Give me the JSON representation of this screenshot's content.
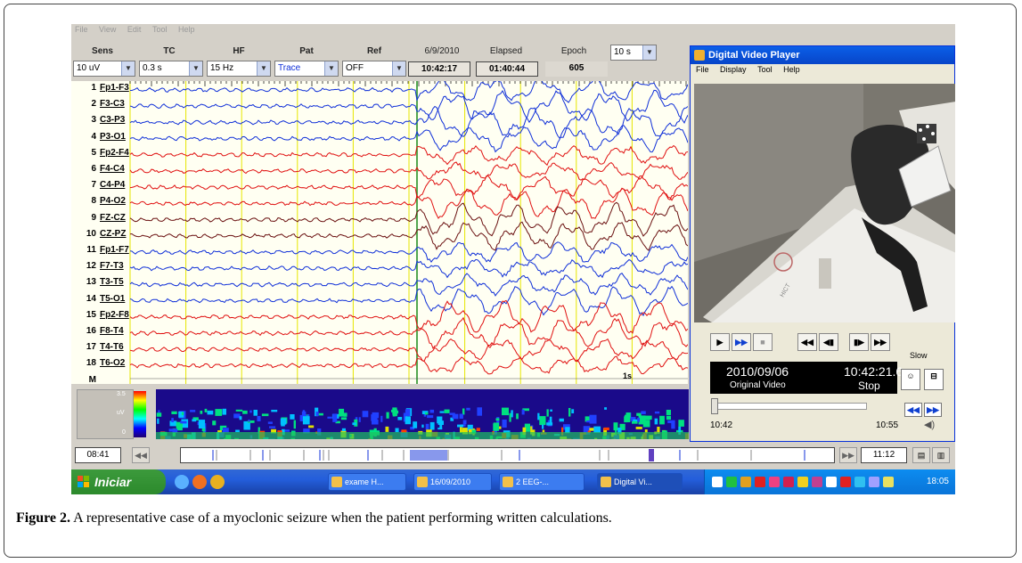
{
  "menubar": [
    "File",
    "View",
    "Edit",
    "Tool",
    "Help"
  ],
  "controls": {
    "labels": {
      "sens": "Sens",
      "tc": "TC",
      "hf": "HF",
      "pat": "Pat",
      "ref": "Ref",
      "date": "6/9/2010",
      "elapsed": "Elapsed",
      "epoch": "Epoch"
    },
    "sens_value": "10 uV",
    "tc_value": "0.3 s",
    "hf_value": "15 Hz",
    "pat_value": "Trace",
    "ref_value": "OFF",
    "clock_time": "10:42:17",
    "elapsed_time": "01:40:44",
    "epoch_value": "605",
    "window_value": "10 s"
  },
  "channels": [
    {
      "n": "1",
      "label": "Fp1-F3"
    },
    {
      "n": "2",
      "label": "F3-C3"
    },
    {
      "n": "3",
      "label": "C3-P3"
    },
    {
      "n": "4",
      "label": "P3-O1"
    },
    {
      "n": "5",
      "label": "Fp2-F4"
    },
    {
      "n": "6",
      "label": "F4-C4"
    },
    {
      "n": "7",
      "label": "C4-P4"
    },
    {
      "n": "8",
      "label": "P4-O2"
    },
    {
      "n": "9",
      "label": "FZ-CZ"
    },
    {
      "n": "10",
      "label": "CZ-PZ"
    },
    {
      "n": "11",
      "label": "Fp1-F7"
    },
    {
      "n": "12",
      "label": "F7-T3"
    },
    {
      "n": "13",
      "label": "T3-T5"
    },
    {
      "n": "14",
      "label": "T5-O1"
    },
    {
      "n": "15",
      "label": "Fp2-F8"
    },
    {
      "n": "16",
      "label": "F8-T4"
    },
    {
      "n": "17",
      "label": "T4-T6"
    },
    {
      "n": "18",
      "label": "T6-O2"
    },
    {
      "n": "M",
      "label": ""
    }
  ],
  "eeg": {
    "scale_label": "1s",
    "colors": {
      "left": "#1030d8",
      "right": "#e01010",
      "midline": "#6a1010",
      "background": "#fffff2",
      "gridline": "#e6e600",
      "marker": "#1a8a1a"
    }
  },
  "spectrum": {
    "scale_top": "3.5",
    "scale_mid": "uV",
    "scale_bottom": "0"
  },
  "timeline": {
    "start": "08:41",
    "end": "11:12"
  },
  "taskbar": {
    "start_label": "Iniciar",
    "tasks": [
      "exame H...",
      "16/09/2010",
      "2 EEG-...",
      "Digital Vi..."
    ],
    "clock": "18:05"
  },
  "player": {
    "title": "Digital Video Player",
    "menu": [
      "File",
      "Display",
      "Tool",
      "Help"
    ],
    "slow_label": "Slow",
    "date": "2010/09/06",
    "time": "10:42:21.6",
    "source": "Original Video",
    "state": "Stop",
    "range_start": "10:42",
    "range_end": "10:55",
    "sticker": "HICT"
  },
  "caption": {
    "label": "Figure 2.",
    "text": " A representative case of a myoclonic seizure when the patient performing written calculations."
  }
}
